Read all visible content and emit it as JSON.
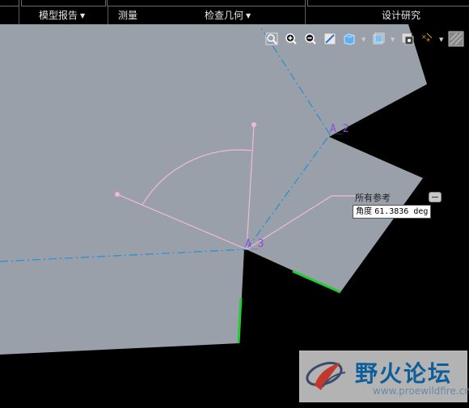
{
  "menubar": {
    "items": [
      {
        "label": "模型报告",
        "has_dropdown": true
      },
      {
        "label": "测量",
        "has_dropdown": false
      },
      {
        "label": "检查几何",
        "has_dropdown": true
      },
      {
        "label": "设计研究",
        "has_dropdown": false
      }
    ]
  },
  "toolbar": {
    "icons": [
      "refit-icon",
      "zoom-in-icon",
      "zoom-out-icon",
      "repaint-icon",
      "saved-views-icon",
      "display-style-icon",
      "view-manager-icon",
      "datum-display-icon",
      "spin-center-icon"
    ]
  },
  "viewport": {
    "background_color": "#9aa0a9",
    "points": {
      "a2": "A_2",
      "a3": "A_3"
    },
    "measurement": {
      "reference_label": "所有参考",
      "angle_prefix": "角度",
      "angle_value": "61.3836 deg"
    }
  },
  "colors": {
    "axis_line": "#1f8fd6",
    "dimension_line": "#f0b8e0",
    "edge_highlight": "#22cc33",
    "point_label": "#8a4fd6"
  },
  "watermark": {
    "title": "野火论坛",
    "url": "www.proewildfire.cn"
  }
}
